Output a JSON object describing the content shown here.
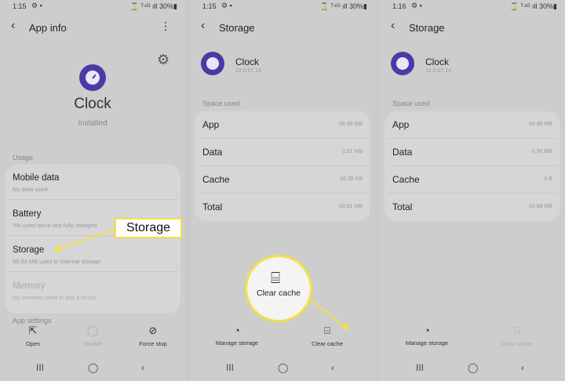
{
  "screen1": {
    "status": {
      "time": "1:15",
      "icons_left": "⚙ ▪",
      "icons_right": "⌛ ᵀ⁴ᴳ ıll 30%▮"
    },
    "header": {
      "back": "‹",
      "title": "App info",
      "menu": "⋮"
    },
    "app": {
      "name": "Clock",
      "status": "Installed"
    },
    "usage_label": "Usage",
    "rows": [
      {
        "title": "Mobile data",
        "sub": "No data used"
      },
      {
        "title": "Battery",
        "sub": "0% used since last fully charged"
      },
      {
        "title": "Storage",
        "sub": "60.93 MB used in Internal storage"
      },
      {
        "title": "Memory",
        "sub": "No memory used in last 3 hours"
      }
    ],
    "app_settings_label": "App settings",
    "actions": [
      {
        "label": "Open",
        "icon": "open-external-icon"
      },
      {
        "label": "Disable",
        "icon": "disable-icon"
      },
      {
        "label": "Force stop",
        "icon": "force-stop-icon"
      }
    ],
    "callout": "Storage"
  },
  "screen2": {
    "status": {
      "time": "1:15",
      "icons_left": "⚙ ▪",
      "icons_right": "⌛ ᵀ⁴ᴳ ıll 30%▮"
    },
    "header": {
      "back": "‹",
      "title": "Storage"
    },
    "app": {
      "name": "Clock",
      "version": "12.0.07.14"
    },
    "space_label": "Space used",
    "rows": [
      {
        "label": "App",
        "value": "59.98 MB"
      },
      {
        "label": "Data",
        "value": "0.91 MB"
      },
      {
        "label": "Cache",
        "value": "16.38 KB"
      },
      {
        "label": "Total",
        "value": "60.91 MB"
      }
    ],
    "actions": [
      {
        "label": "Manage storage",
        "icon": "manage-storage-icon"
      },
      {
        "label": "Clear cache",
        "icon": "clear-cache-icon"
      }
    ],
    "callout": "Clear cache"
  },
  "screen3": {
    "status": {
      "time": "1:16",
      "icons_left": "⚙ ▪",
      "icons_right": "⌛ ᵀ⁴ᴳ ıll 30%▮"
    },
    "header": {
      "back": "‹",
      "title": "Storage"
    },
    "app": {
      "name": "Clock",
      "version": "12.0.07.14"
    },
    "space_label": "Space used",
    "rows": [
      {
        "label": "App",
        "value": "59.98 MB"
      },
      {
        "label": "Data",
        "value": "0.90 MB"
      },
      {
        "label": "Cache",
        "value": "0 B"
      },
      {
        "label": "Total",
        "value": "60.88 MB"
      }
    ],
    "actions": [
      {
        "label": "Manage storage",
        "icon": "manage-storage-icon"
      },
      {
        "label": "Clear cache",
        "icon": "clear-cache-icon"
      }
    ]
  },
  "navbar": {
    "recents": "III",
    "home": "◯",
    "back": "‹"
  },
  "colors": {
    "accent_yellow": "#f2e04a",
    "app_icon": "#4a3aa6",
    "screen_bg": "#cdcdcd"
  }
}
